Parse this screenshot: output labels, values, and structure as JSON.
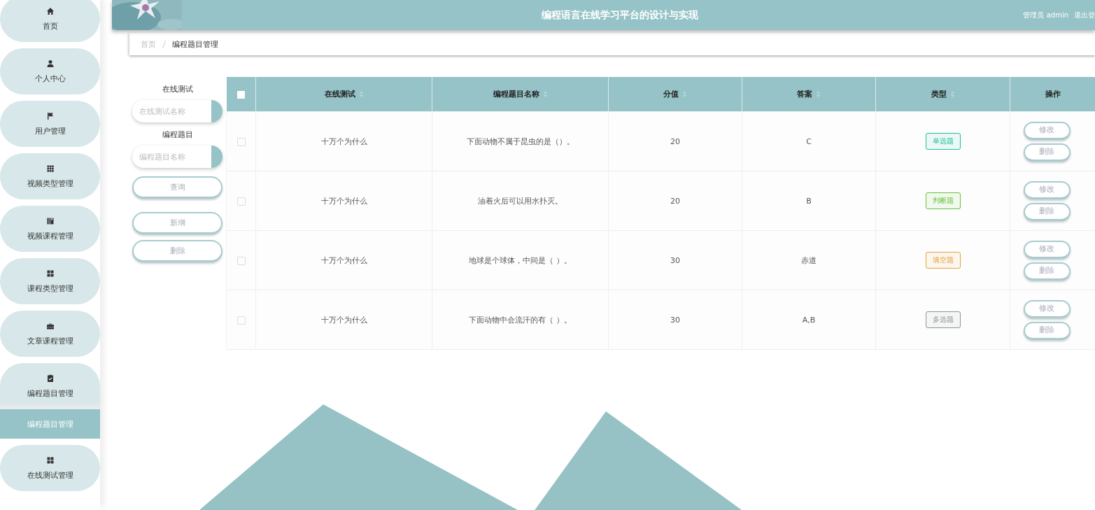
{
  "sidebar": {
    "items": [
      {
        "label": "首页",
        "expanded": false
      },
      {
        "label": "个人中心",
        "expanded": false
      },
      {
        "label": "用户管理",
        "expanded": false
      },
      {
        "label": "视频类型管理",
        "expanded": false
      },
      {
        "label": "视频课程管理",
        "expanded": false
      },
      {
        "label": "课程类型管理",
        "expanded": false
      },
      {
        "label": "文章课程管理",
        "expanded": false
      },
      {
        "label": "编程题目管理",
        "expanded": true,
        "children": [
          {
            "label": "编程题目管理",
            "selected": true
          }
        ]
      },
      {
        "label": "在线测试管理",
        "expanded": false
      }
    ]
  },
  "header": {
    "title": "编程语言在线学习平台的设计与实现",
    "user": "管理员 admin",
    "logout": "退出登"
  },
  "breadcrumb": [
    "首页",
    "编程题目管理"
  ],
  "search": {
    "fields": [
      {
        "label": "在线测试",
        "placeholder": "在线测试名称"
      },
      {
        "label": "编程题目",
        "placeholder": "编程题目名称"
      }
    ],
    "buttons": [
      "查询",
      "新增",
      "删除"
    ]
  },
  "table": {
    "select_all": {
      "checked": false
    },
    "columns": [
      {
        "label": "在线测试",
        "sortable": true
      },
      {
        "label": "编程题目名称",
        "sortable": true
      },
      {
        "label": "分值",
        "sortable": true
      },
      {
        "label": "答案",
        "sortable": true
      },
      {
        "label": "类型",
        "sortable": true
      },
      {
        "label": "操作",
        "sortable": false
      }
    ],
    "rows": [
      {
        "checked": false,
        "cells": [
          "十万个为什么",
          "下面动物不属于昆虫的是（）。",
          "20",
          "C"
        ],
        "type": {
          "label": "单选题",
          "color": "#1fbf9a"
        },
        "actions": [
          "修改",
          "删除"
        ]
      },
      {
        "checked": false,
        "cells": [
          "十万个为什么",
          "油着火后可以用水扑灭。",
          "20",
          "B"
        ],
        "type": {
          "label": "判断题",
          "color": "#67c23a"
        },
        "actions": [
          "修改",
          "删除"
        ]
      },
      {
        "checked": false,
        "cells": [
          "十万个为什么",
          "地球是个球体，中间是（ ）。",
          "30",
          "赤道"
        ],
        "type": {
          "label": "填空题",
          "color": "#e6a23c"
        },
        "actions": [
          "修改",
          "删除"
        ]
      },
      {
        "checked": false,
        "cells": [
          "十万个为什么",
          "下面动物中会流汗的有（ ）。",
          "30",
          "A,B"
        ],
        "type": {
          "label": "多选题",
          "color": "#909399"
        },
        "actions": [
          "修改",
          "删除"
        ]
      }
    ]
  }
}
